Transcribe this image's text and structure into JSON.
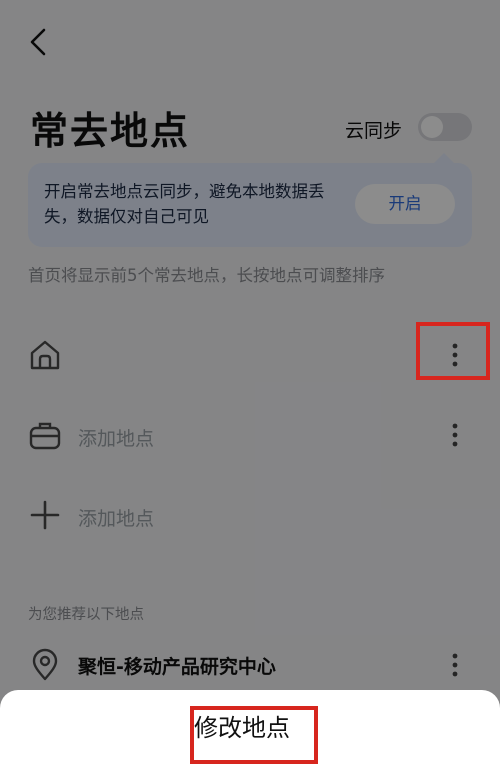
{
  "header": {
    "title": "常去地点",
    "cloud_sync_label": "云同步",
    "cloud_sync_enabled": false
  },
  "sync_tip": {
    "text": "开启常去地点云同步，避免本地数据丢失，数据仅对自己可见",
    "button_label": "开启"
  },
  "hint": "首页将显示前5个常去地点，长按地点可调整排序",
  "places": [
    {
      "icon": "home-icon",
      "label": ""
    },
    {
      "icon": "briefcase-icon",
      "label": "添加地点"
    },
    {
      "icon": "plus-icon",
      "label": "添加地点"
    }
  ],
  "recommend": {
    "section_label": "为您推荐以下地点",
    "items": [
      {
        "icon": "location-pin-icon",
        "label": "聚恒-移动产品研究中心"
      }
    ]
  },
  "action_sheet": {
    "items": [
      "修改地点"
    ]
  },
  "colors": {
    "accent": "#2f6bdc",
    "highlight": "#d7261e"
  }
}
